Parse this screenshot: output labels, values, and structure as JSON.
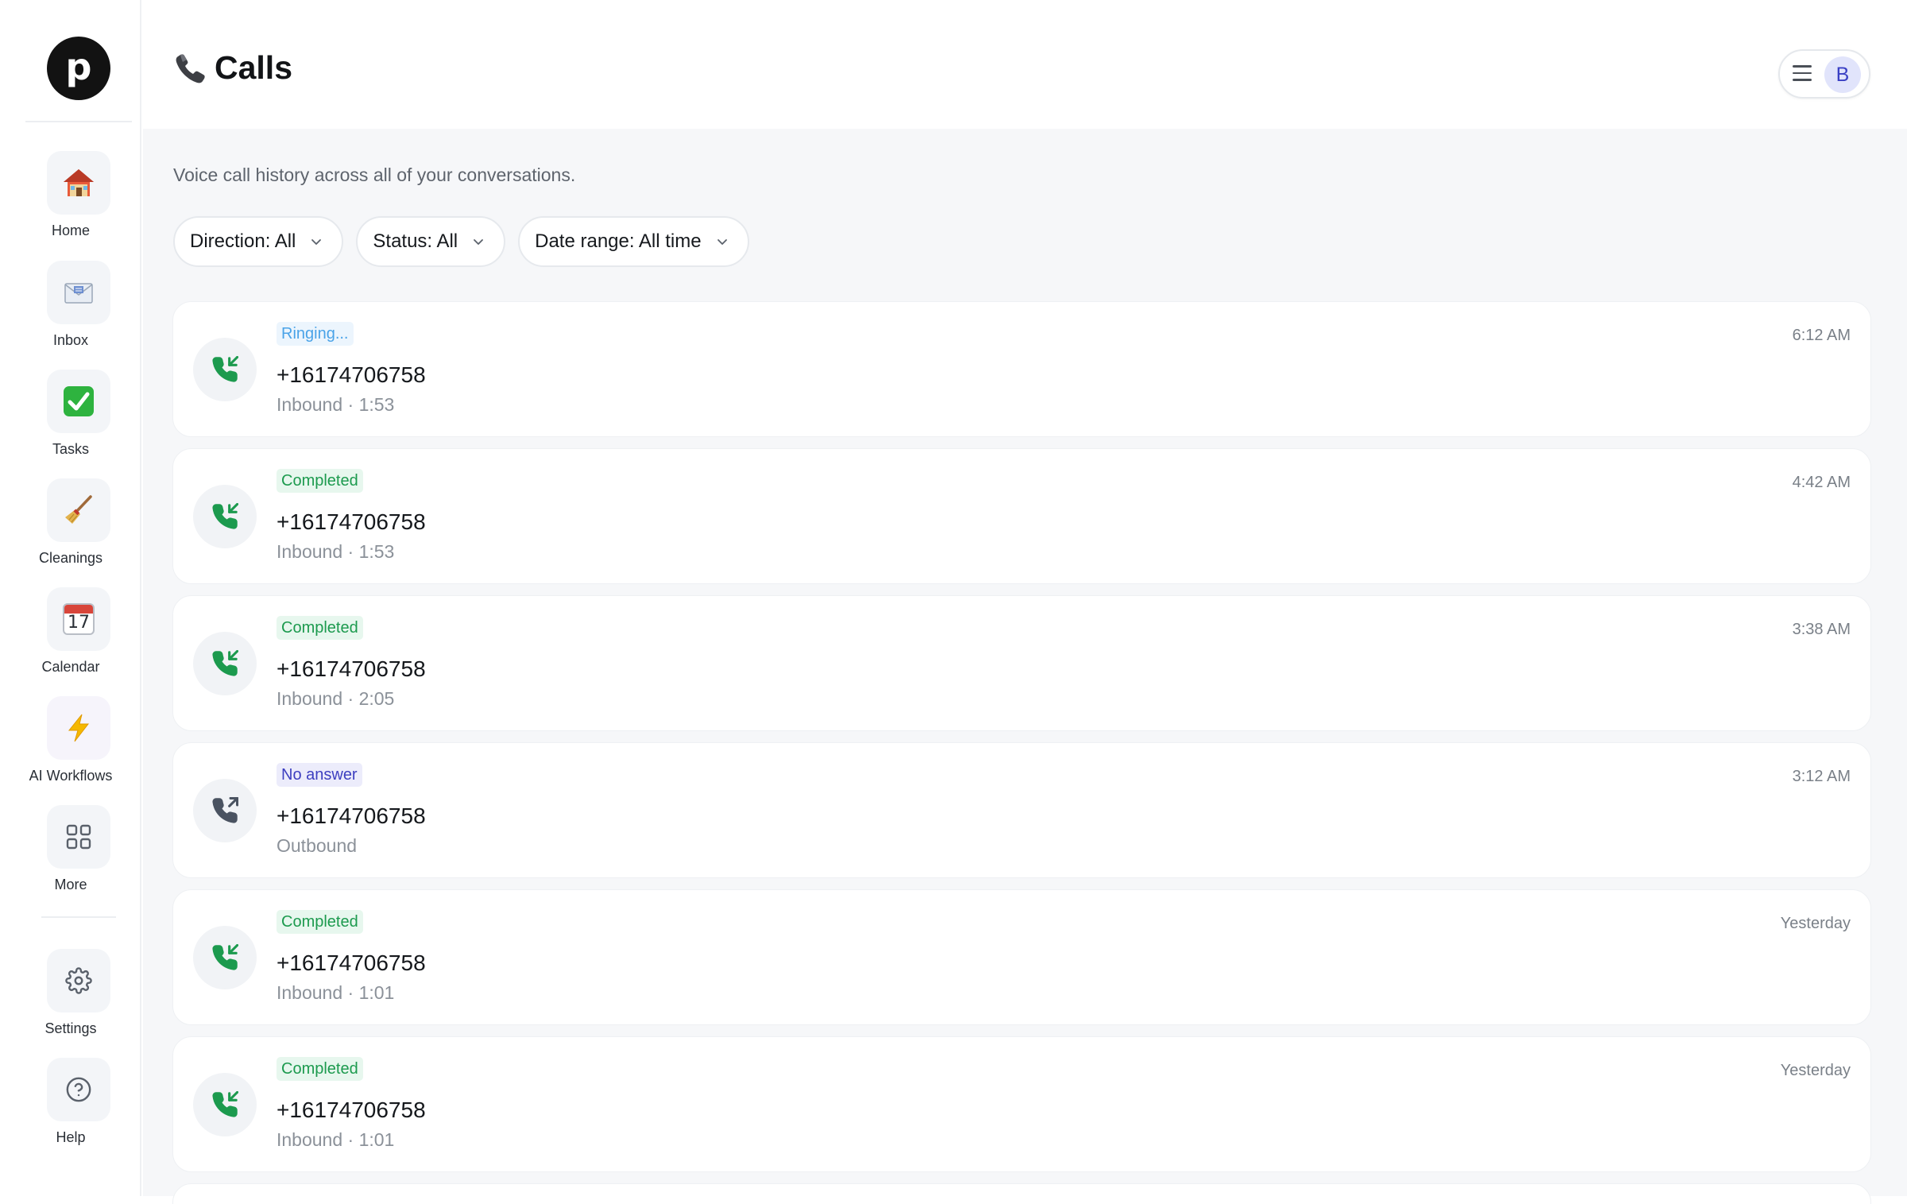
{
  "app": {
    "logo_letter": "p"
  },
  "sidebar": {
    "items": [
      {
        "label": "Home",
        "icon": "house-icon"
      },
      {
        "label": "Inbox",
        "icon": "envelope-icon"
      },
      {
        "label": "Tasks",
        "icon": "checkmark-icon"
      },
      {
        "label": "Cleanings",
        "icon": "broom-icon"
      },
      {
        "label": "Calendar",
        "icon": "calendar-icon",
        "calendar_day": "17"
      },
      {
        "label": "AI Workflows",
        "icon": "lightning-icon"
      },
      {
        "label": "More",
        "icon": "grid-icon"
      }
    ],
    "bottom_items": [
      {
        "label": "Settings",
        "icon": "gear-icon"
      },
      {
        "label": "Help",
        "icon": "help-icon"
      }
    ]
  },
  "header": {
    "title": "Calls",
    "title_icon": "phone-icon",
    "avatar_letter": "B"
  },
  "main": {
    "subtitle": "Voice call history across all of your conversations.",
    "filters": [
      {
        "label": "Direction: All"
      },
      {
        "label": "Status: All"
      },
      {
        "label": "Date range: All time"
      }
    ],
    "calls": [
      {
        "status": "Ringing...",
        "status_type": "ringing",
        "number": "+16174706758",
        "meta": "Inbound · 1:53",
        "time": "6:12 AM",
        "direction": "inbound"
      },
      {
        "status": "Completed",
        "status_type": "completed",
        "number": "+16174706758",
        "meta": "Inbound · 1:53",
        "time": "4:42 AM",
        "direction": "inbound"
      },
      {
        "status": "Completed",
        "status_type": "completed",
        "number": "+16174706758",
        "meta": "Inbound · 2:05",
        "time": "3:38 AM",
        "direction": "inbound"
      },
      {
        "status": "No answer",
        "status_type": "noanswer",
        "number": "+16174706758",
        "meta": "Outbound",
        "time": "3:12 AM",
        "direction": "outbound"
      },
      {
        "status": "Completed",
        "status_type": "completed",
        "number": "+16174706758",
        "meta": "Inbound · 1:01",
        "time": "Yesterday",
        "direction": "inbound"
      },
      {
        "status": "Completed",
        "status_type": "completed",
        "number": "+16174706758",
        "meta": "Inbound · 1:01",
        "time": "Yesterday",
        "direction": "inbound"
      }
    ]
  },
  "colors": {
    "inbound_icon": "#1c9a4e",
    "outbound_icon": "#4a5361",
    "avatar_bg": "#e1e4fb",
    "avatar_text": "#3a40c4"
  }
}
